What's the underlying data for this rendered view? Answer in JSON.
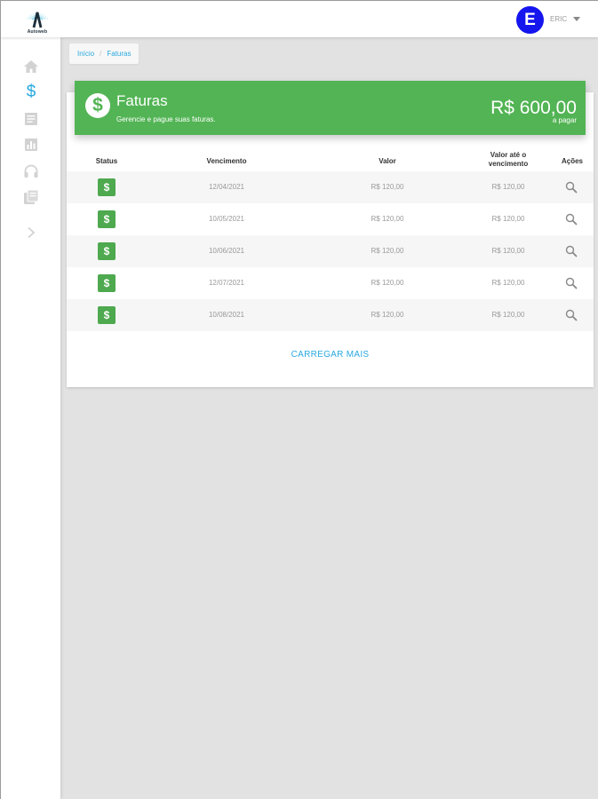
{
  "header": {
    "logo_text": "Autoweb",
    "avatar_initial": "E",
    "user_name": "ERIC"
  },
  "sidebar": {
    "items": [
      {
        "name": "home-icon"
      },
      {
        "name": "dollar-icon",
        "active": true,
        "glyph": "$"
      },
      {
        "name": "document-icon"
      },
      {
        "name": "bar-chart-icon"
      },
      {
        "name": "headset-icon"
      },
      {
        "name": "gallery-icon"
      },
      {
        "name": "chevron-right-icon"
      }
    ]
  },
  "breadcrumb": {
    "home": "Início",
    "separator": "/",
    "current": "Faturas"
  },
  "banner": {
    "icon_glyph": "$",
    "title": "Faturas",
    "subtitle": "Gerencie e pague suas faturas.",
    "amount": "R$ 600,00",
    "amount_label": "a pagar"
  },
  "table": {
    "headers": {
      "status": "Status",
      "vencimento": "Vencimento",
      "valor": "Valor",
      "valor_ate_line1": "Valor até o",
      "valor_ate_line2": "vencimento",
      "acoes": "Ações"
    },
    "rows": [
      {
        "status_glyph": "$",
        "vencimento": "12/04/2021",
        "valor": "R$ 120,00",
        "valor_ate": "R$ 120,00"
      },
      {
        "status_glyph": "$",
        "vencimento": "10/05/2021",
        "valor": "R$ 120,00",
        "valor_ate": "R$ 120,00"
      },
      {
        "status_glyph": "$",
        "vencimento": "10/06/2021",
        "valor": "R$ 120,00",
        "valor_ate": "R$ 120,00"
      },
      {
        "status_glyph": "$",
        "vencimento": "12/07/2021",
        "valor": "R$ 120,00",
        "valor_ate": "R$ 120,00"
      },
      {
        "status_glyph": "$",
        "vencimento": "10/08/2021",
        "valor": "R$ 120,00",
        "valor_ate": "R$ 120,00"
      }
    ]
  },
  "load_more": "CARREGAR MAIS",
  "colors": {
    "brand_green": "#52b454",
    "accent_blue": "#29a9e0",
    "avatar_blue": "#1515ee"
  }
}
